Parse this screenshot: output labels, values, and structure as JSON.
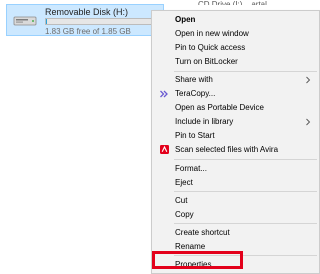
{
  "drive": {
    "name": "Removable Disk (H:)",
    "free_text": "1.83 GB free of 1.85 GB",
    "used_fraction": 0.011,
    "icon": "drive-icon"
  },
  "background_drive": {
    "name": "CD Drive (I:) ...artal"
  },
  "menu": {
    "open": "Open",
    "open_new_window": "Open in new window",
    "pin_quick_access": "Pin to Quick access",
    "bitlocker": "Turn on BitLocker",
    "share_with": "Share with",
    "teracopy": "TeraCopy...",
    "open_portable": "Open as Portable Device",
    "include_library": "Include in library",
    "pin_start": "Pin to Start",
    "scan_avira": "Scan selected files with Avira",
    "format": "Format...",
    "eject": "Eject",
    "cut": "Cut",
    "copy": "Copy",
    "create_shortcut": "Create shortcut",
    "rename": "Rename",
    "properties": "Properties"
  },
  "icons": {
    "teracopy": "teracopy-icon",
    "avira": "avira-icon",
    "submenu": "chevron-right-icon"
  },
  "colors": {
    "selection_bg": "#cce8ff",
    "highlight": "#e3001b",
    "avira_red": "#e3001b",
    "teracopy_purple": "#6b5bd2"
  }
}
